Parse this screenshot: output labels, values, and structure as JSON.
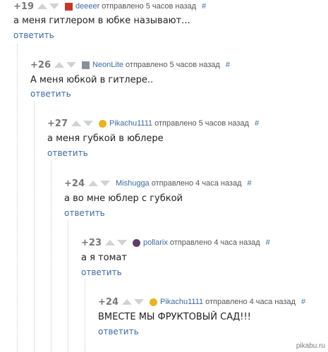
{
  "comments": [
    {
      "rating": "+19",
      "username": "deeeer",
      "meta": "отправлено 5 часов назад",
      "hash": "#",
      "text": "а меня гитлером в юбке называют...",
      "reply": "ответить",
      "avatar_color": "#c0392b"
    },
    {
      "rating": "+26",
      "username": "NeonLite",
      "meta": "отправлено 5 часов назад",
      "hash": "#",
      "text": "А меня юбкой в гитлере..",
      "reply": "ответить",
      "avatar_color": "#8a8f99"
    },
    {
      "rating": "+27",
      "username": "Pikachu1111",
      "meta": "отправлено 5 часов назад",
      "hash": "#",
      "text": "а меня губкой в юблере",
      "reply": "ответить",
      "avatar_color": "#e6b422"
    },
    {
      "rating": "+24",
      "username": "Mishugga",
      "meta": "отправлено 4 часа назад",
      "hash": "#",
      "text": "а во мне юблер с губкой",
      "reply": "ответить",
      "avatar_color": ""
    },
    {
      "rating": "+23",
      "username": "pollarix",
      "meta": "отправлено 4 часа назад",
      "hash": "#",
      "text": "а я томат",
      "reply": "ответить",
      "avatar_color": "#5a3d6b"
    },
    {
      "rating": "+24",
      "username": "Pikachu1111",
      "meta": "отправлено 4 часа назад",
      "hash": "#",
      "text": "ВМЕСТЕ МЫ ФРУКТОВЫЙ САД!!!",
      "reply": "ответить",
      "avatar_color": "#e6b422"
    }
  ],
  "watermark": "pikabu.ru"
}
